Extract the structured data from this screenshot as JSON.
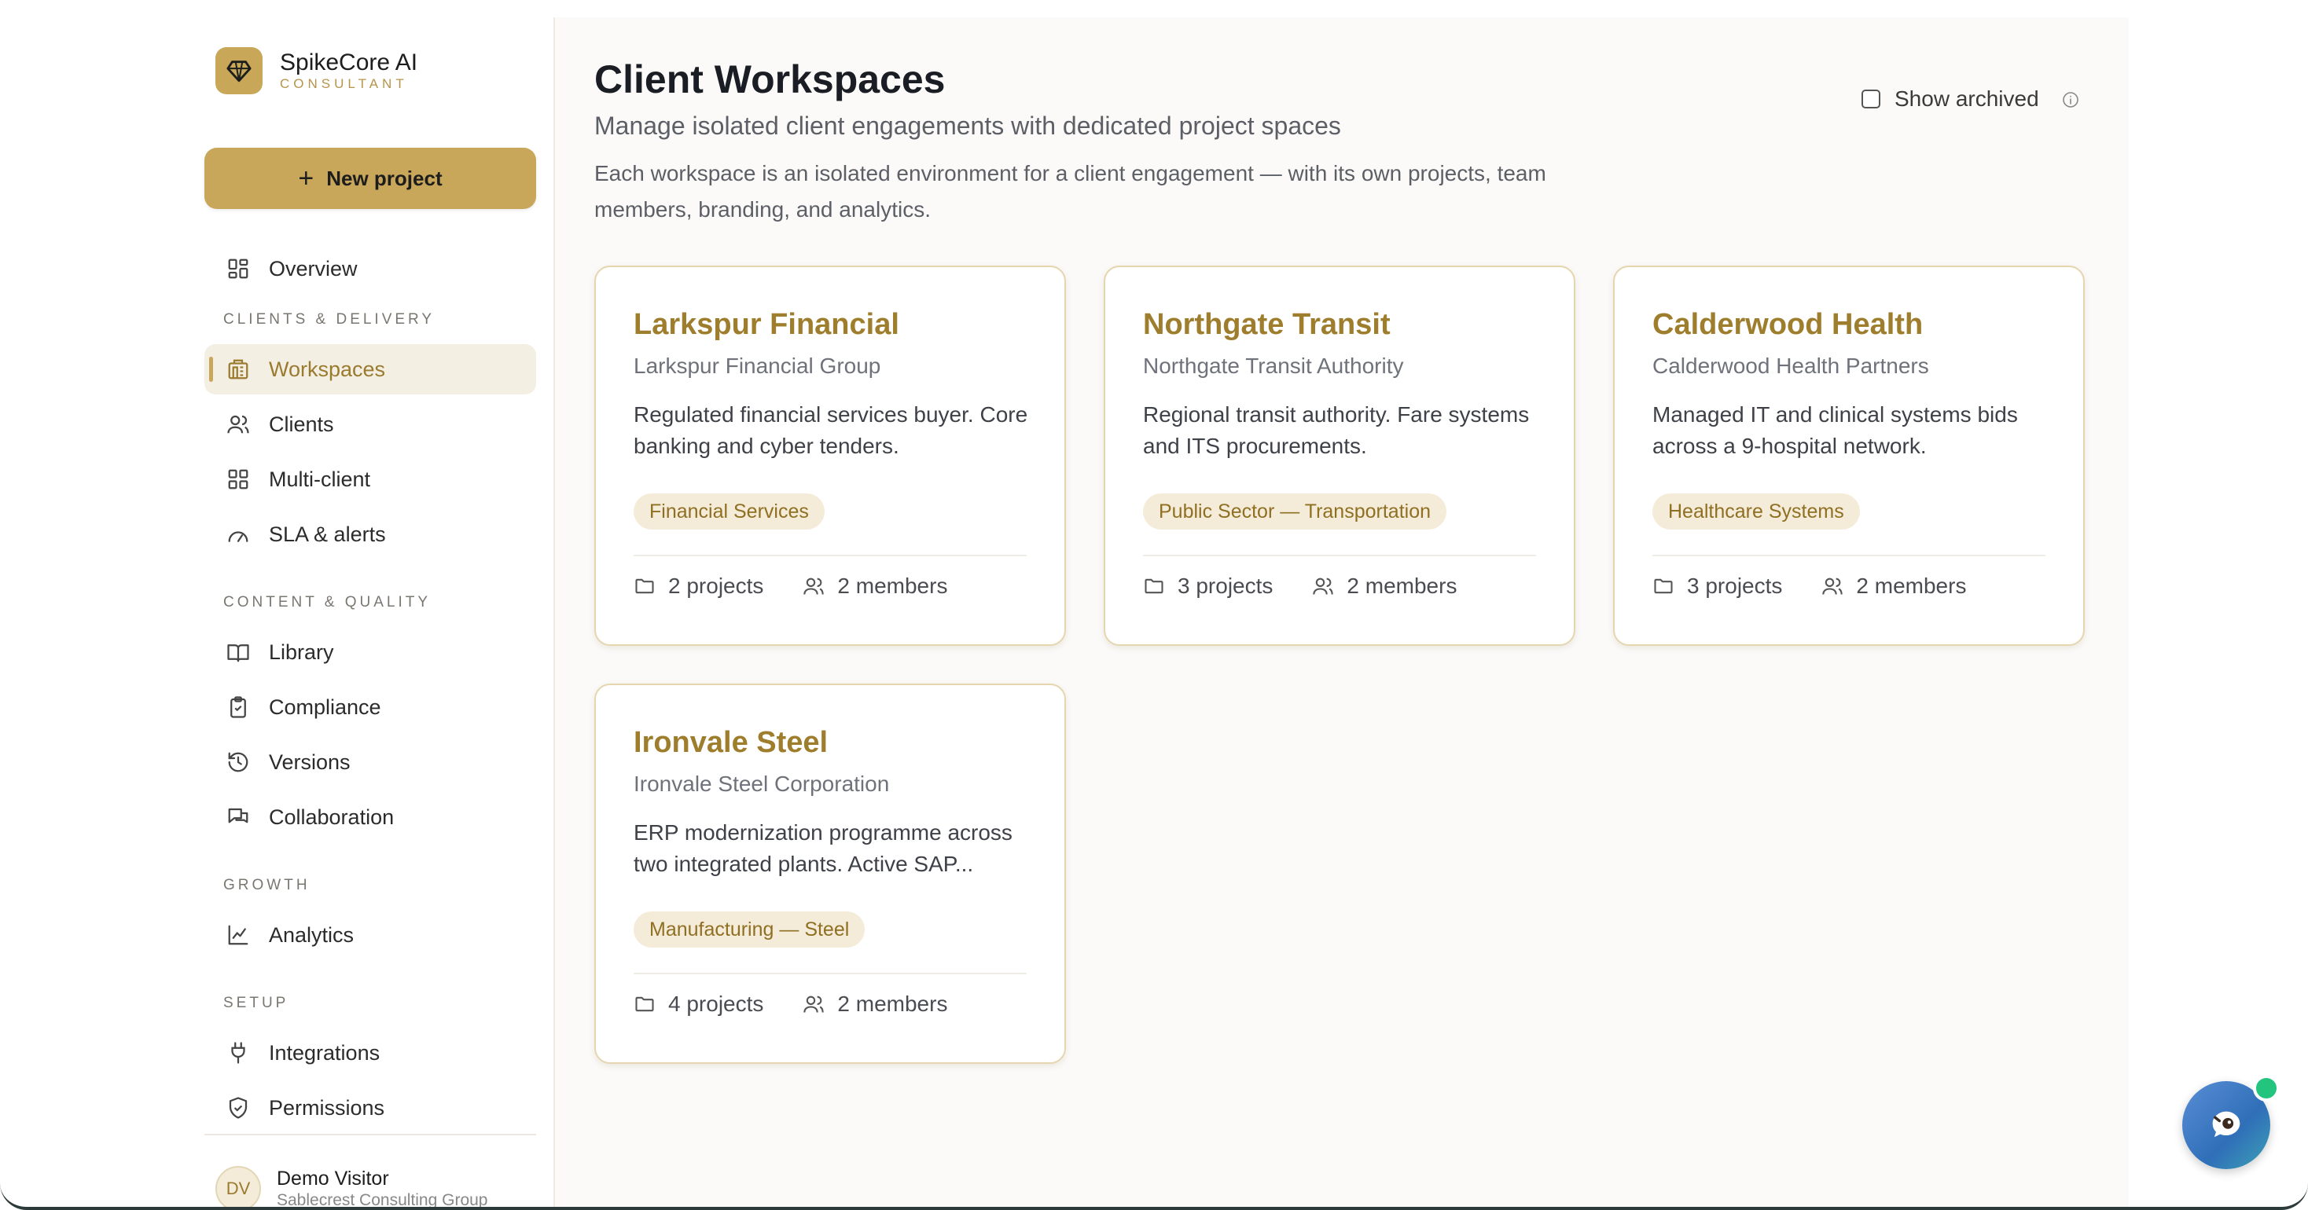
{
  "brand": {
    "name": "SpikeCore AI",
    "subtitle": "CONSULTANT"
  },
  "sidebar": {
    "new_project_label": "New project",
    "overview_label": "Overview",
    "sections": [
      {
        "title": "CLIENTS & DELIVERY",
        "items": [
          "Workspaces",
          "Clients",
          "Multi-client",
          "SLA & alerts"
        ]
      },
      {
        "title": "CONTENT & QUALITY",
        "items": [
          "Library",
          "Compliance",
          "Versions",
          "Collaboration"
        ]
      },
      {
        "title": "GROWTH",
        "items": [
          "Analytics"
        ]
      },
      {
        "title": "SETUP",
        "items": [
          "Integrations",
          "Permissions"
        ]
      }
    ],
    "active_item": "Workspaces"
  },
  "user": {
    "initials": "DV",
    "name": "Demo Visitor",
    "org": "Sablecrest Consulting Group"
  },
  "page": {
    "title": "Client Workspaces",
    "subtitle": "Manage isolated client engagements with dedicated project spaces",
    "description": "Each workspace is an isolated environment for a client engagement — with its own projects, team members, branding, and analytics.",
    "show_archived_label": "Show archived",
    "show_archived_checked": false
  },
  "workspaces": [
    {
      "name": "Larkspur Financial",
      "org": "Larkspur Financial Group",
      "description": "Regulated financial services buyer. Core banking and cyber tenders.",
      "tag": "Financial Services",
      "projects": "2 projects",
      "members": "2 members"
    },
    {
      "name": "Northgate Transit",
      "org": "Northgate Transit Authority",
      "description": "Regional transit authority. Fare systems and ITS procurements.",
      "tag": "Public Sector — Transportation",
      "projects": "3 projects",
      "members": "2 members"
    },
    {
      "name": "Calderwood Health",
      "org": "Calderwood Health Partners",
      "description": "Managed IT and clinical systems bids across a 9-hospital network.",
      "tag": "Healthcare Systems",
      "projects": "3 projects",
      "members": "2 members"
    },
    {
      "name": "Ironvale Steel",
      "org": "Ironvale Steel Corporation",
      "description": "ERP modernization programme across two integrated plants. Active SAP...",
      "tag": "Manufacturing — Steel",
      "projects": "4 projects",
      "members": "2 members"
    }
  ],
  "colors": {
    "accent": "#c8a65a",
    "accent_text": "#9e7d2c",
    "tag_bg": "#f4ecd8",
    "online": "#23c47e"
  }
}
